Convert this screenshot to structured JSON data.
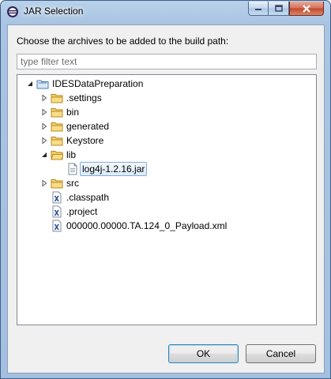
{
  "window": {
    "title": "JAR Selection"
  },
  "dialog": {
    "prompt": "Choose the archives to be added to the build path:",
    "filter_placeholder": "type filter text"
  },
  "tree": {
    "root": "IDESDataPreparation",
    "items": [
      {
        "label": ".settings",
        "icon": "folder-icon",
        "expanded": false
      },
      {
        "label": "bin",
        "icon": "folder-icon",
        "expanded": false
      },
      {
        "label": "generated",
        "icon": "folder-icon",
        "expanded": false
      },
      {
        "label": "Keystore",
        "icon": "folder-icon",
        "expanded": false
      },
      {
        "label": "lib",
        "icon": "folder-icon",
        "expanded": true
      },
      {
        "label": "log4j-1.2.16.jar",
        "icon": "jar-file-icon",
        "selected": true
      },
      {
        "label": "src",
        "icon": "folder-icon",
        "expanded": false
      },
      {
        "label": ".classpath",
        "icon": "xml-file-icon"
      },
      {
        "label": ".project",
        "icon": "xml-file-icon"
      },
      {
        "label": "000000.00000.TA.124_0_Payload.xml",
        "icon": "xml-file-icon"
      }
    ]
  },
  "buttons": {
    "ok": "OK",
    "cancel": "Cancel"
  },
  "colors": {
    "selection": "#dbebfb",
    "folder": "#e8b84a",
    "title_bar": "#b9d1ea"
  }
}
